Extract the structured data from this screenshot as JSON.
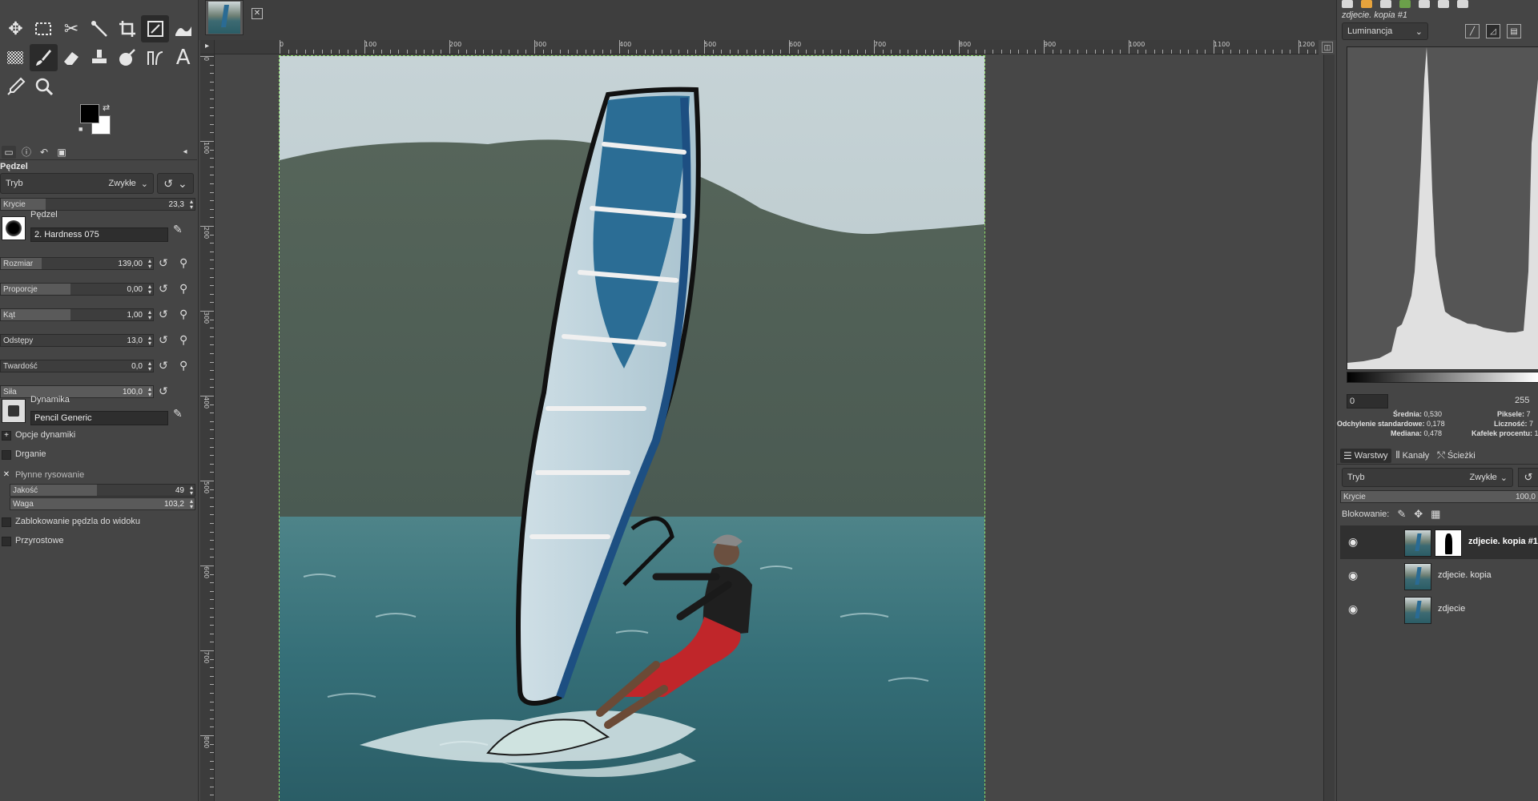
{
  "toolbox": {
    "tools": [
      [
        "move-tool",
        "rect-select-tool",
        "scissors-select-tool",
        "fuzzy-select-tool",
        "crop-tool",
        "unified-transform-tool",
        "warp-tool"
      ],
      [
        "gradient-tool",
        "paintbrush-tool",
        "eraser-tool",
        "clone-tool",
        "smudge-tool",
        "paths-tool",
        "text-tool"
      ],
      [
        "color-picker-tool",
        "zoom-tool"
      ]
    ],
    "active_tool": "paintbrush-tool"
  },
  "tool_options": {
    "title": "Pędzel",
    "mode_label": "Tryb",
    "mode_value": "Zwykłe",
    "opacity_label": "Krycie",
    "opacity_value": "23,3",
    "opacity_fraction": 0.233,
    "brush_label": "Pędzel",
    "brush_name": "2. Hardness 075",
    "sliders": [
      {
        "label": "Rozmiar",
        "value": "139,00",
        "fraction": 0.27
      },
      {
        "label": "Proporcje",
        "value": "0,00",
        "fraction": 0.46
      },
      {
        "label": "Kąt",
        "value": "1,00",
        "fraction": 0.46
      },
      {
        "label": "Odstępy",
        "value": "13,0",
        "fraction": 0.0
      },
      {
        "label": "Twardość",
        "value": "0,0",
        "fraction": 0.0
      },
      {
        "label": "Siła",
        "value": "100,0",
        "fraction": 1.0
      }
    ],
    "dynamics_label": "Dynamika",
    "dynamics_name": "Pencil Generic",
    "dynamics_options_label": "Opcje dynamiki",
    "jitter_label": "Drganie",
    "smooth_label": "Płynne rysowanie",
    "quality_label": "Jakość",
    "quality_value": "49",
    "quality_fraction": 0.47,
    "weight_label": "Waga",
    "weight_value": "103,2",
    "weight_fraction": 1.0,
    "lock_brush_label": "Zablokowanie pędzla do widoku",
    "incremental_label": "Przyrostowe"
  },
  "canvas": {
    "ruler_marks": [
      "0",
      "100",
      "200",
      "300",
      "400",
      "500",
      "600",
      "700",
      "800",
      "900",
      "1000",
      "1100",
      "1200"
    ],
    "vruler_marks": [
      "0",
      "100",
      "200",
      "300",
      "400",
      "500",
      "600",
      "700",
      "800"
    ]
  },
  "dock": {
    "active_layer_title": "zdjecie. kopia #1",
    "histogram_channel": "Luminancja",
    "range_min": "0",
    "range_max": "255",
    "stats": {
      "mean_label": "Średnia:",
      "mean_value": "0,530",
      "std_label": "Odchylenie standardowe:",
      "std_value": "0,178",
      "median_label": "Mediana:",
      "median_value": "0,478",
      "pixels_label": "Piksele:",
      "pixels_value": "7",
      "count_label": "Liczność:",
      "count_value": "7",
      "percentile_label": "Kafelek procentu:",
      "percentile_value": "1"
    },
    "tabs": [
      {
        "label": "Warstwy",
        "icon": "layers-icon"
      },
      {
        "label": "Kanały",
        "icon": "channels-icon"
      },
      {
        "label": "Ścieżki",
        "icon": "paths-icon"
      }
    ],
    "layer_mode_label": "Tryb",
    "layer_mode_value": "Zwykłe",
    "layer_opacity_label": "Krycie",
    "layer_opacity_value": "100,0",
    "lock_label": "Blokowanie:",
    "layers": [
      {
        "name": "zdjecie. kopia #1",
        "selected": true,
        "has_mask": true
      },
      {
        "name": "zdjecie. kopia",
        "selected": false,
        "has_mask": false
      },
      {
        "name": "zdjecie",
        "selected": false,
        "has_mask": false
      }
    ]
  }
}
